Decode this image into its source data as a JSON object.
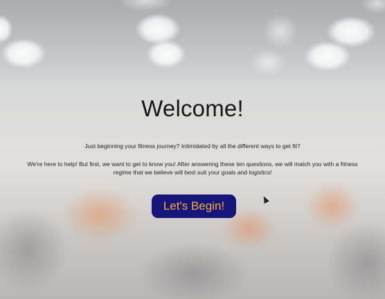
{
  "welcome": {
    "title": "Welcome!",
    "intro": "Just beginning your fitness journey? Intimidated by all the different ways to get fit?",
    "body": "We're here to help! But first, we want to get to know you! After answering these ten questions, we will match you with a fitness regime that we believe will best suit your goals and logistics!",
    "begin_label": "Let's Begin!"
  },
  "colors": {
    "button_bg": "#16157a",
    "button_text": "#f5b23c"
  }
}
